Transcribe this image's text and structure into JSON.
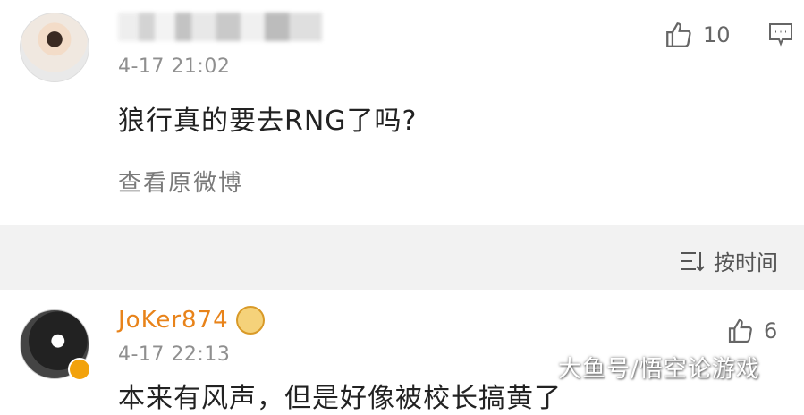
{
  "comment1": {
    "time": "4-17 21:02",
    "text": "狼行真的要去RNG了吗?",
    "view_original": "查看原微博",
    "likes": "10"
  },
  "sort": {
    "label": "按时间"
  },
  "comment2": {
    "username": "JoKer874",
    "time": "4-17 22:13",
    "likes": "6",
    "text": "本来有风声，但是好像被校长搞黄了"
  },
  "watermark": "大鱼号/悟空论游戏",
  "icons": {
    "like": "thumbs-up-icon",
    "comment": "comment-icon",
    "sort": "sort-icon",
    "vip": "vip-badge-icon"
  }
}
